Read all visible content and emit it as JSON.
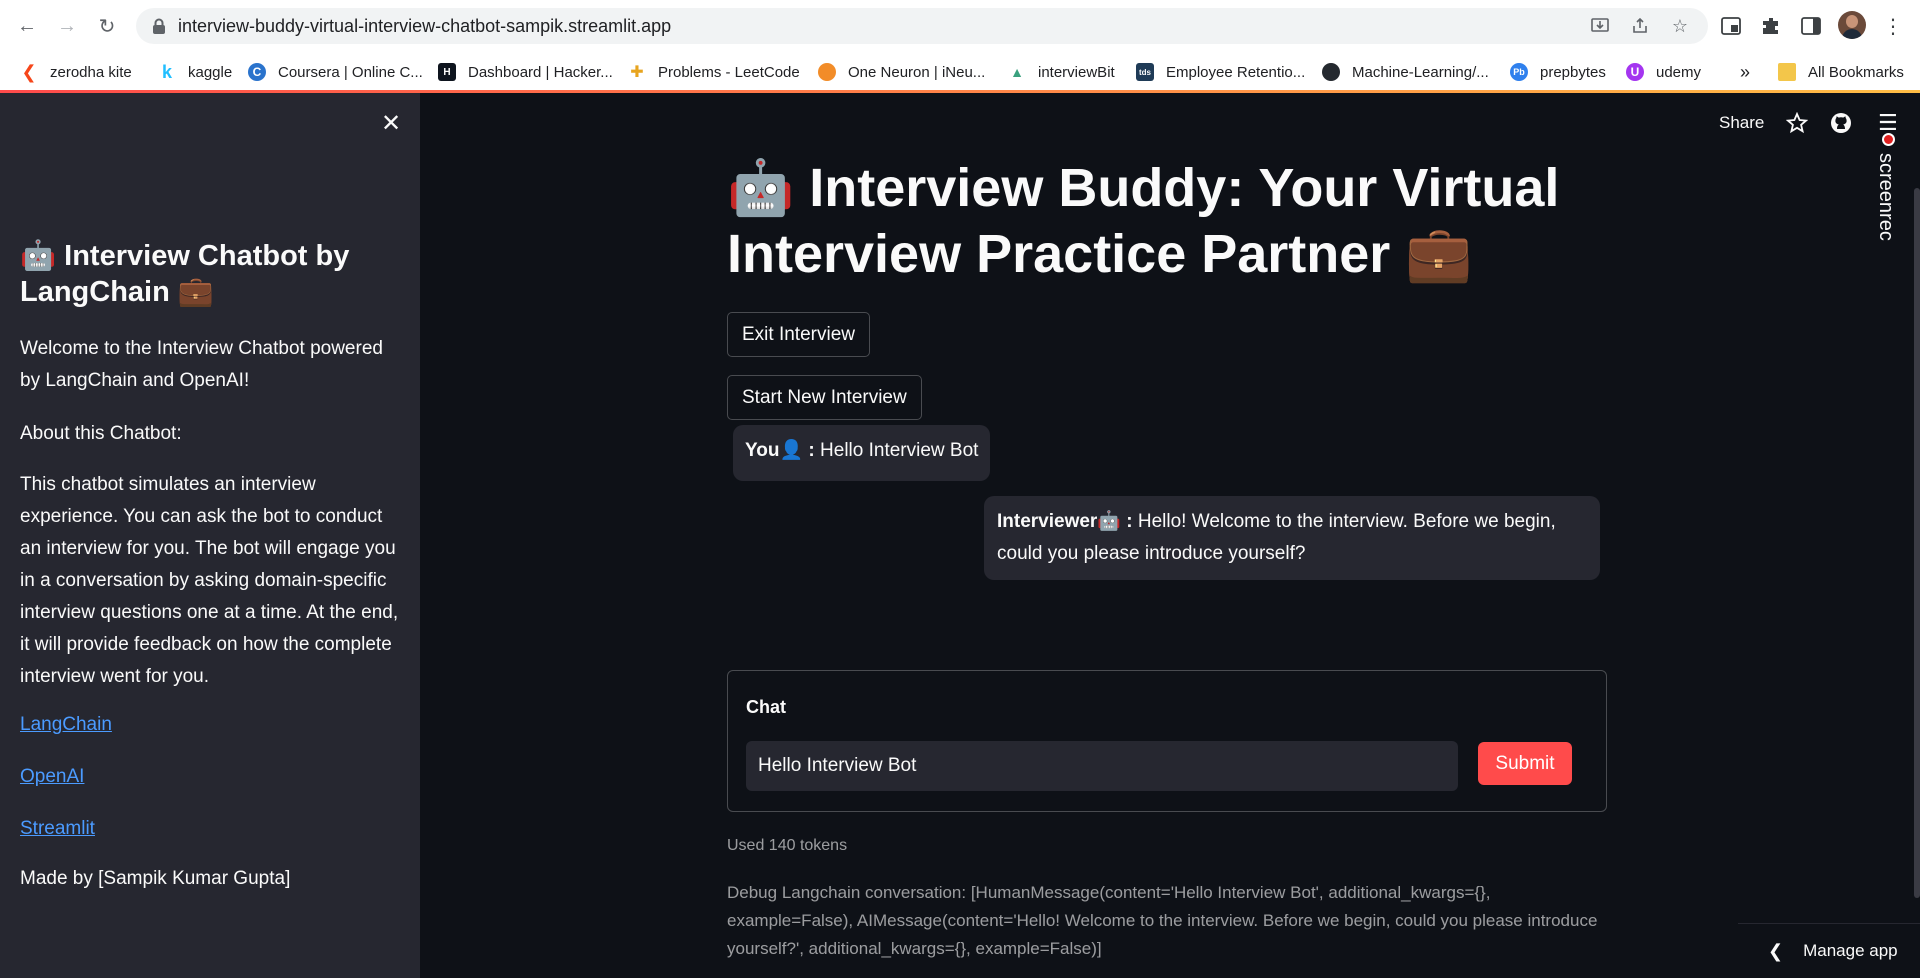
{
  "browser": {
    "url": "interview-buddy-virtual-interview-chatbot-sampik.streamlit.app",
    "bookmarks": [
      "zerodha kite",
      "kaggle",
      "Coursera | Online C...",
      "Dashboard | Hacker...",
      "Problems - LeetCode",
      "One Neuron | iNeu...",
      "interviewBit",
      "Employee Retentio...",
      "Machine-Learning/...",
      "prepbytes",
      "udemy"
    ],
    "more_bookmarks": "»",
    "all_bookmarks": "All Bookmarks"
  },
  "sidebar": {
    "title": "🤖 Interview Chatbot by LangChain 💼",
    "welcome": "Welcome to the Interview Chatbot powered by LangChain and OpenAI!",
    "about_heading": "About this Chatbot:",
    "about_text": "This chatbot simulates an interview experience. You can ask the bot to conduct an interview for you. The bot will engage you in a conversation by asking domain-specific interview questions one at a time. At the end, it will provide feedback on how the complete interview went for you.",
    "links": [
      "LangChain",
      "OpenAI",
      "Streamlit"
    ],
    "made_by": "Made by [Sampik Kumar Gupta]"
  },
  "header": {
    "share": "Share"
  },
  "main": {
    "title": "🤖 Interview Buddy: Your Virtual Interview Practice Partner 💼",
    "exit_button": "Exit Interview",
    "new_button": "Start New Interview",
    "messages": [
      {
        "speaker": "You👤 : ",
        "text": "Hello Interview Bot"
      },
      {
        "speaker": "Interviewer🤖 : ",
        "text": "Hello! Welcome to the interview. Before we begin, could you please introduce yourself?"
      }
    ],
    "form": {
      "title": "Chat",
      "input_value": "Hello Interview Bot",
      "submit": "Submit"
    },
    "tokens": "Used 140 tokens",
    "debug": "Debug Langchain conversation: [HumanMessage(content='Hello Interview Bot', additional_kwargs={}, example=False), AIMessage(content='Hello! Welcome to the interview. Before we begin, could you please introduce yourself?', additional_kwargs={}, example=False)]"
  },
  "overlay": {
    "screenrec": "screenrec",
    "manage_app": "Manage app"
  }
}
